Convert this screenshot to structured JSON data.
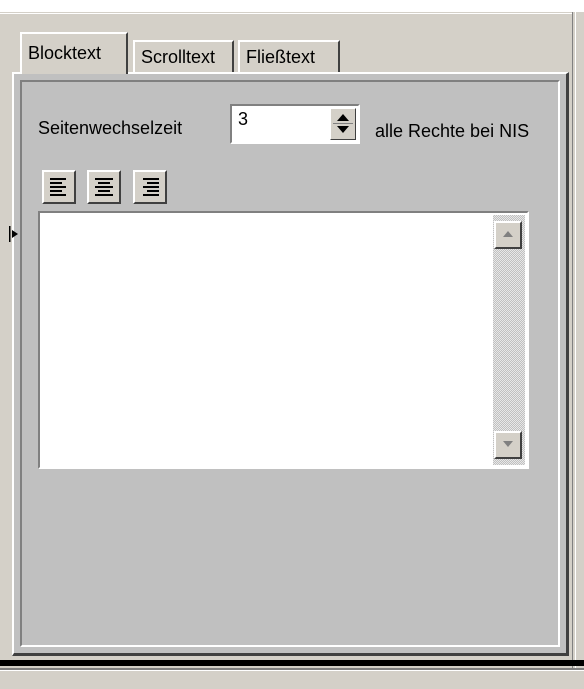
{
  "tabs": [
    {
      "label": "Blocktext",
      "active": true
    },
    {
      "label": "Scrolltext",
      "active": false
    },
    {
      "label": "Fließtext",
      "active": false
    }
  ],
  "settings": {
    "page_change_label": "Seitenwechselzeit",
    "page_change_value": "3",
    "rights_label": "alle Rechte bei NIS"
  },
  "toolbar": {
    "icons": [
      "align-left-icon",
      "align-center-icon",
      "align-right-icon"
    ]
  },
  "editor": {
    "value": ""
  }
}
